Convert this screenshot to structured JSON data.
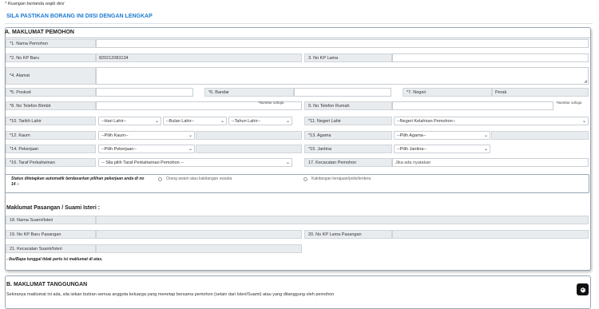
{
  "note": "* Ruangan bertanda wajib diisi",
  "main_title": "SILA PASTIKAN BORANG INI DIISI DENGAN LENGKAP",
  "section_a": {
    "title": "A. MAKLUMAT PEMOHON",
    "fields": {
      "nama_pemohon": {
        "label": "*1. Nama Pemohon",
        "value": ""
      },
      "no_kp_baru": {
        "label": "*2. No KP Baru",
        "value": "820212083134"
      },
      "no_kp_lama": {
        "label": "3. No KP Lama",
        "value": ""
      },
      "alamat": {
        "label": "*4. Alamat",
        "value": ""
      },
      "poskod": {
        "label": "*5. Poskod",
        "value": ""
      },
      "bandar": {
        "label": "*6. Bandar",
        "value": ""
      },
      "negeri": {
        "label": "*7. Negeri",
        "value": "Perak"
      },
      "no_telefon_bimbit": {
        "label": "*8. No Telefon Bimbit",
        "value": "",
        "hint": "*Nombor sahaja"
      },
      "no_telefon_rumah": {
        "label": "9. No Telefon Rumah",
        "value": "",
        "hint": "*Nombor sahaja"
      },
      "tarikh_lahir": {
        "label": "*10. Tarikh Lahir",
        "hari": "--Hari Lahir--",
        "bulan": "--Bulan Lahir--",
        "tahun": "--Tahun Lahir--"
      },
      "negeri_lahir": {
        "label": "*11. Negeri Lahir",
        "value": "--Negeri Kelahiran Pemohon--"
      },
      "kaum": {
        "label": "*12. Kaum",
        "value": "--Pilih Kaum--"
      },
      "agama": {
        "label": "*13. Agama",
        "value": "--Pilih Agama--"
      },
      "pekerjaan": {
        "label": "*14. Pekerjaan",
        "value": "--Pilih Pekerjaan--"
      },
      "jantina": {
        "label": "*15. Jantina",
        "value": "--Pilih Jantina--"
      },
      "taraf_perkahwinan": {
        "label": "*16. Taraf Perkahwinan",
        "value": "-- Sila pilih Taraf Perkahwinan Pemohon --"
      },
      "kecacatan_pemohon": {
        "label": "17. Kecacatan Pemohon",
        "placeholder": "Jika ada nyatakan"
      }
    },
    "status": {
      "label": "Status ditetapkan automatik berdasarkan pilihan pekerjaan anda di no 14 :-",
      "option_1": "Orang awam atau kakitangan swasta",
      "option_2": "Kakitangan kerajaan/polis/tentera"
    },
    "pasangan": {
      "title": "Maklumat Pasangan / Suami Isteri :",
      "nama_suami_isteri": {
        "label": "18. Nama Suami/Isteri",
        "value": ""
      },
      "no_kp_baru_pasangan": {
        "label": "19. No KP Baru Pasangan",
        "value": ""
      },
      "no_kp_lama_pasangan": {
        "label": "20. No KP Lama Pasangan",
        "value": ""
      },
      "kecacatan_suami_isteri": {
        "label": "21. Kecacatan Suami/Isteri",
        "value": ""
      },
      "footnote": "- Ibu/Bapa tunggal tidak perlu isi maklumat di atas."
    }
  },
  "section_b": {
    "title": "B. MAKLUMAT TANGGUNGAN",
    "description": "Sekiranya maklumat ini ada, sila isikan butiran semua anggota keluarga yang menetap bersama pemohon (selain dari Isteri/Suami) atau yang ditanggung oleh pemohon"
  },
  "icons": {
    "settings": "gear-icon",
    "dropdown": "chevron-down-icon",
    "resize": "resize-handle-icon"
  }
}
